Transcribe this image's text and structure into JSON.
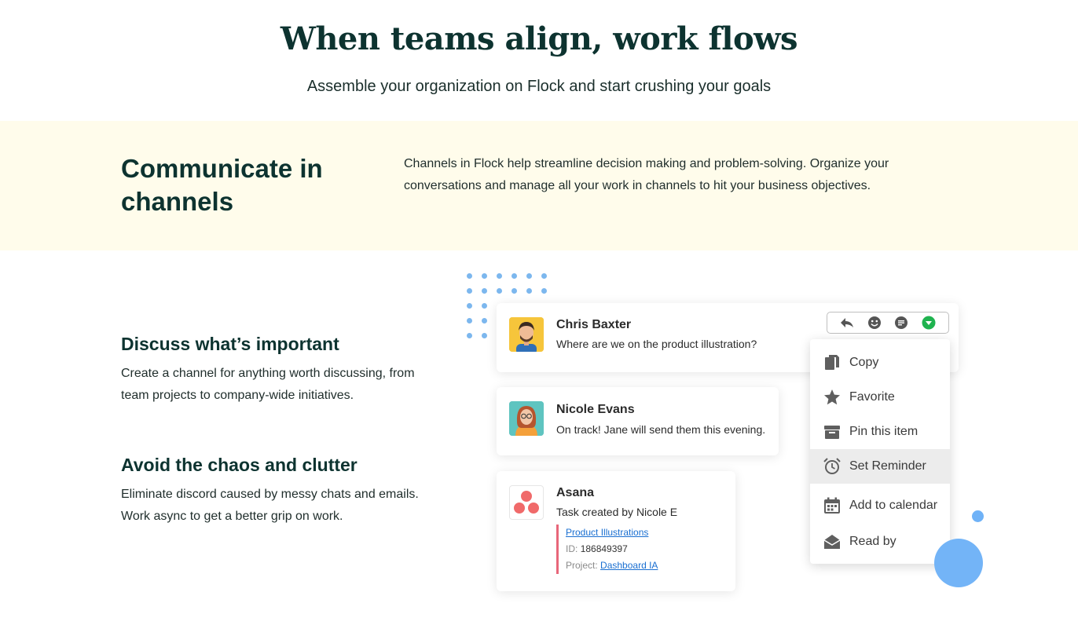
{
  "hero": {
    "title": "When teams align, work flows",
    "subtitle": "Assemble your organization on Flock and start crushing your goals"
  },
  "band": {
    "title": "Communicate in channels",
    "text": "Channels in Flock help streamline decision making and problem-solving. Organize your conversations and manage all your work in channels to hit your business objectives.",
    "background_color": "#fffceb"
  },
  "features": [
    {
      "title": "Discuss what’s important",
      "text": "Create a channel for anything worth discussing, from team projects to company-wide initiatives."
    },
    {
      "title": "Avoid the chaos and clutter",
      "text": "Eliminate discord caused by messy chats and emails. Work async to get a better grip on work."
    }
  ],
  "messages": [
    {
      "name": "Chris Baxter",
      "text": "Where are we on the product illustration?",
      "avatar": "man-avatar"
    },
    {
      "name": "Nicole Evans",
      "text": "On track! Jane will send them this evening.",
      "avatar": "woman-avatar"
    },
    {
      "name": "Asana",
      "text": "Task created by Nicole E",
      "avatar": "asana-logo"
    }
  ],
  "asana_task": {
    "title": "Product Illustrations",
    "id_label": "ID:",
    "id_value": "186849397",
    "project_label": "Project:",
    "project_value": "Dashboard IA",
    "accent_color": "#e8677a"
  },
  "toolbar": {
    "icons": [
      "reply-icon",
      "emoji-icon",
      "comment-icon",
      "dropdown-icon"
    ],
    "dropdown_color": "#1fb34f"
  },
  "menu": {
    "items": [
      {
        "label": "Copy",
        "icon": "copy-icon"
      },
      {
        "label": "Favorite",
        "icon": "star-icon"
      },
      {
        "label": "Pin this item",
        "icon": "pin-icon"
      },
      {
        "label": "Set Reminder",
        "icon": "alarm-icon",
        "active": true
      },
      {
        "label": "Add to calendar",
        "icon": "calendar-icon"
      },
      {
        "label": "Read by",
        "icon": "envelope-open-icon"
      }
    ]
  },
  "colors": {
    "heading": "#0d3330",
    "decor_blue": "#73b4f7",
    "link": "#1a6fd1"
  }
}
